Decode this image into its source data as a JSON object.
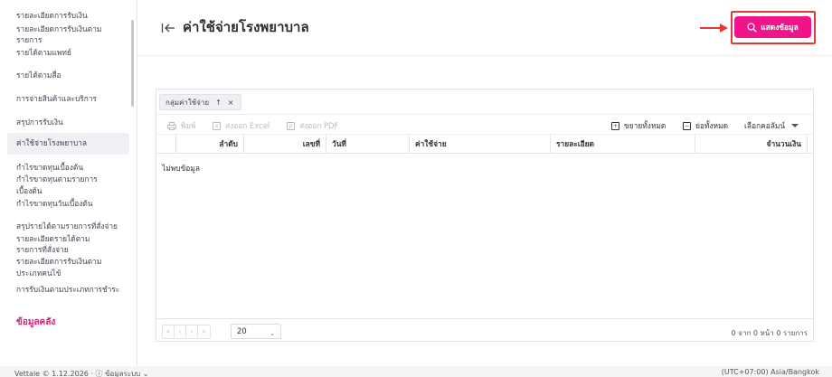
{
  "sidebar": {
    "items": [
      {
        "label": "รายละเอียดการรับเงิน"
      },
      {
        "label": "รายละเอียดการรับเงินตามรายการ"
      },
      {
        "label": "รายได้ตามแพทย์"
      },
      {
        "label": "รายได้ตามสื่อ"
      },
      {
        "label": "การจ่ายสินค้าและบริการ"
      },
      {
        "label": "สรุปการรับเงิน"
      },
      {
        "label": "ค่าใช้จ่ายโรงพยาบาล"
      },
      {
        "label": "กำไรขาดทุนเบื้องต้น"
      },
      {
        "label": "กำไรขาดทุนตามรายการเบื้องต้น"
      },
      {
        "label": "กำไรขาดทุนวันเบื้องต้น"
      },
      {
        "label": "สรุปรายได้ตามรายการที่สั่งจ่าย"
      },
      {
        "label": "รายละเอียดรายได้ตามรายการที่สั่งจ่าย"
      },
      {
        "label": "รายละเอียดการรับเงินตามประเภทคนไข้"
      },
      {
        "label": "การรับเงินตามประเภทการชำระ"
      }
    ],
    "section_heading": "ข้อมูลคลัง"
  },
  "header": {
    "back_icon": "collapse-left-icon",
    "title": "ค่าใช้จ่ายโรงพยาบาล",
    "show_button": "แสดงข้อมูล"
  },
  "grid": {
    "group_chip": {
      "label": "กลุ่มค่าใช้จ่าย",
      "sort_icon": "↑",
      "remove_icon": "×"
    },
    "toolbar": {
      "print": "พิมพ์",
      "export_excel": "ส่งออก Excel",
      "export_pdf": "ส่งออก PDF",
      "expand_all": "ขยายทั้งหมด",
      "collapse_all": "ย่อทั้งหมด",
      "choose_columns": "เลือกคอลัมน์"
    },
    "columns": [
      "ลำดับ",
      "เลขที่",
      "วันที่",
      "ค่าใช้จ่าย",
      "รายละเอียด",
      "จำนวนเงิน"
    ],
    "no_data": "ไม่พบข้อมูล",
    "pager": {
      "first": "«",
      "prev": "‹",
      "next": "›",
      "last": "»",
      "page_size": "20",
      "info": "0 จาก 0 หน้า 0 รายการ"
    }
  },
  "footer": {
    "left": "Vettale © 1.12.2026 · ⓘ ข้อมูลระบบ ⌄",
    "right": "(UTC+07:00) Asia/Bangkok"
  },
  "colors": {
    "accent": "#f0138a",
    "highlight": "#e53935",
    "sidebar_heading": "#e0157e"
  }
}
